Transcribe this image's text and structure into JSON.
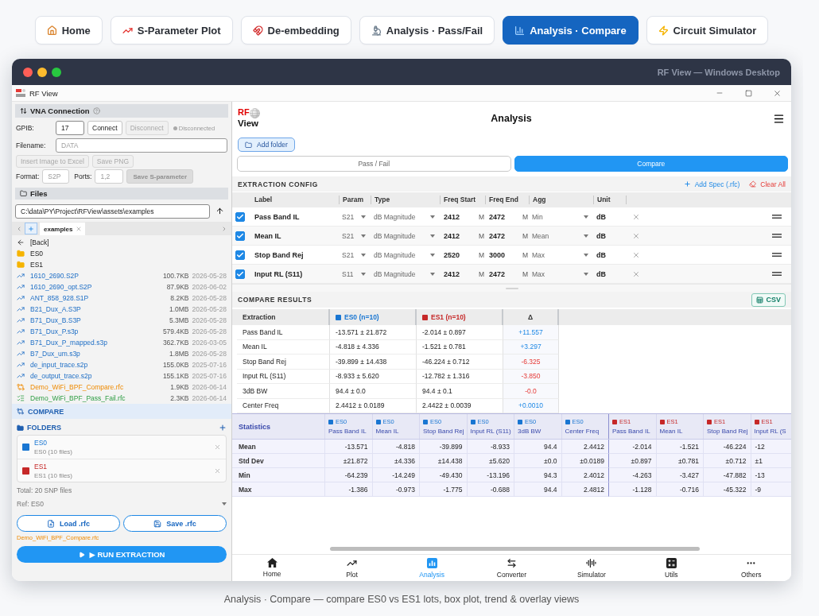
{
  "nav_tabs": [
    {
      "kind": "home",
      "label": "Home",
      "selected": false
    },
    {
      "kind": "plot",
      "label": "S-Parameter Plot",
      "selected": false
    },
    {
      "kind": "deembed",
      "label": "De-embedding",
      "selected": false
    },
    {
      "kind": "passfail",
      "label": "Analysis · Pass/Fail",
      "selected": false
    },
    {
      "kind": "compare",
      "label": "Analysis · Compare",
      "selected": true
    },
    {
      "kind": "simulator",
      "label": "Circuit Simulator",
      "selected": false
    }
  ],
  "window": {
    "title": "RF View — Windows Desktop",
    "app_title": "RF View"
  },
  "vna": {
    "title": "VNA Connection",
    "gpib_label": "GPIB:",
    "gpib": {
      "value": "17",
      "disabled": false
    },
    "connect": {
      "label": "Connect",
      "disabled": false
    },
    "disconnect": {
      "label": "Disconnect",
      "disabled": true
    },
    "connected": false,
    "status": "Disconnected",
    "filename_label": "Filename:",
    "filename": {
      "placeholder": "DATA"
    },
    "export_buttons": [
      {
        "label": "Insert Image to Excel",
        "disabled": true
      },
      {
        "label": "Save PNG",
        "disabled": true
      }
    ],
    "format_label": "Format:",
    "format": {
      "value": "S2P",
      "disabled": true
    },
    "ports_label": "Ports:",
    "ports": {
      "value": "1,2",
      "disabled": true
    },
    "save_button": {
      "label": "Save S-parameter",
      "disabled": true
    }
  },
  "files": {
    "title": "Files",
    "path": "C:\\data\\PY\\Project\\RFView\\assets\\examples",
    "tabs": [
      {
        "label": "examples",
        "selected": true
      }
    ],
    "items": [
      {
        "kind": "back",
        "name": "[Back]"
      },
      {
        "kind": "folder",
        "name": "ES0"
      },
      {
        "kind": "folder",
        "name": "ES1"
      },
      {
        "kind": "trace",
        "name": "1610_2690.S2P",
        "size": "100.7KB",
        "date": "2026-05-28"
      },
      {
        "kind": "trace",
        "name": "1610_2690_opt.S2P",
        "size": "87.9KB",
        "date": "2026-06-02"
      },
      {
        "kind": "trace",
        "name": "ANT_858_928.S1P",
        "size": "8.2KB",
        "date": "2026-05-28"
      },
      {
        "kind": "trace",
        "name": "B21_Dux_A.S3P",
        "size": "1.0MB",
        "date": "2026-05-28"
      },
      {
        "kind": "trace",
        "name": "B71_Dux_B.S3P",
        "size": "5.3MB",
        "date": "2026-05-28"
      },
      {
        "kind": "trace",
        "name": "B71_Dux_P.s3p",
        "size": "579.4KB",
        "date": "2026-05-28"
      },
      {
        "kind": "trace",
        "name": "B71_Dux_P_mapped.s3p",
        "size": "362.7KB",
        "date": "2026-03-05"
      },
      {
        "kind": "trace",
        "name": "B7_Dux_um.s3p",
        "size": "1.8MB",
        "date": "2026-05-28"
      },
      {
        "kind": "trace",
        "name": "de_input_trace.s2p",
        "size": "155.0KB",
        "date": "2025-07-16"
      },
      {
        "kind": "trace",
        "name": "de_output_trace.s2p",
        "size": "155.1KB",
        "date": "2025-07-16"
      },
      {
        "kind": "compare",
        "name": "Demo_WiFi_BPF_Compare.rfc",
        "size": "1.9KB",
        "date": "2026-06-14"
      },
      {
        "kind": "passfail",
        "name": "Demo_WiFi_BPF_Pass_Fail.rfc",
        "size": "2.3KB",
        "date": "2026-06-14"
      }
    ]
  },
  "compare": {
    "title": "COMPARE",
    "folders_title": "FOLDERS",
    "folders": [
      {
        "name": "ES0",
        "detail": "ES0 (10 files)",
        "color": "#1976d2"
      },
      {
        "name": "ES1",
        "detail": "ES1 (10 files)",
        "color": "#c62828"
      }
    ],
    "total": "Total: 20 SNP files",
    "ref": "Ref: ES0",
    "load_button": "Load .rfc",
    "save_button": "Save .rfc",
    "current_file": "Demo_WiFi_BPF_Compare.rfc",
    "run_button": "▶ RUN EXTRACTION"
  },
  "header": {
    "logo_top": "RF",
    "logo_bottom": "View",
    "title": "Analysis"
  },
  "add_folder": "Add folder",
  "mode_tabs": [
    {
      "label": "Pass / Fail",
      "selected": false
    },
    {
      "label": "Compare",
      "selected": true
    }
  ],
  "extraction_config": {
    "title": "EXTRACTION CONFIG",
    "add_spec": "Add Spec (.rfc)",
    "clear_all": "Clear All",
    "columns": [
      "Label",
      "Param",
      "Type",
      "Freq Start",
      "Freq End",
      "Agg",
      "Unit"
    ],
    "rows": [
      {
        "checked": true,
        "label": "Pass Band IL",
        "param": "S21",
        "type": "dB Magnitude",
        "freq_start": "2412",
        "freq_start_unit": "M",
        "freq_end": "2472",
        "freq_end_unit": "M",
        "agg": "Min",
        "unit": "dB"
      },
      {
        "checked": true,
        "label": "Mean IL",
        "param": "S21",
        "type": "dB Magnitude",
        "freq_start": "2412",
        "freq_start_unit": "M",
        "freq_end": "2472",
        "freq_end_unit": "M",
        "agg": "Mean",
        "unit": "dB"
      },
      {
        "checked": true,
        "label": "Stop Band Rej",
        "param": "S21",
        "type": "dB Magnitude",
        "freq_start": "2520",
        "freq_start_unit": "M",
        "freq_end": "3000",
        "freq_end_unit": "M",
        "agg": "Max",
        "unit": "dB"
      },
      {
        "checked": true,
        "label": "Input RL (S11)",
        "param": "S11",
        "type": "dB Magnitude",
        "freq_start": "2412",
        "freq_start_unit": "M",
        "freq_end": "2472",
        "freq_end_unit": "M",
        "agg": "Max",
        "unit": "dB"
      }
    ]
  },
  "compare_results": {
    "title": "COMPARE RESULTS",
    "csv_button": "CSV",
    "columns": [
      {
        "label": "Extraction"
      },
      {
        "label": "ES0 (n=10)",
        "color": "#1976d2"
      },
      {
        "label": "ES1 (n=10)",
        "color": "#c62828"
      },
      {
        "label": "Δ"
      }
    ],
    "rows": [
      {
        "label": "Pass Band IL",
        "es0": "-13.571 ± 21.872",
        "es1": "-2.014 ± 0.897",
        "delta": "+11.557",
        "kind": "gain"
      },
      {
        "label": "Mean IL",
        "es0": "-4.818 ± 4.336",
        "es1": "-1.521 ± 0.781",
        "delta": "+3.297",
        "kind": "gain"
      },
      {
        "label": "Stop Band Rej",
        "es0": "-39.899 ± 14.438",
        "es1": "-46.224 ± 0.712",
        "delta": "-6.325",
        "kind": "loss"
      },
      {
        "label": "Input RL (S11)",
        "es0": "-8.933 ± 5.620",
        "es1": "-12.782 ± 1.316",
        "delta": "-3.850",
        "kind": "loss"
      },
      {
        "label": "3dB BW",
        "es0": "94.4 ± 0.0",
        "es1": "94.4 ± 0.1",
        "delta": "-0.0",
        "kind": "loss"
      },
      {
        "label": "Center Freq",
        "es0": "2.4412 ± 0.0189",
        "es1": "2.4422 ± 0.0039",
        "delta": "+0.0010",
        "kind": "gain"
      }
    ]
  },
  "statistics": {
    "title": "Statistics",
    "columns": [
      {
        "group": "ES0",
        "label": "Pass Band IL",
        "color": "#1976d2"
      },
      {
        "group": "ES0",
        "label": "Mean IL",
        "color": "#1976d2"
      },
      {
        "group": "ES0",
        "label": "Stop Band Rej",
        "color": "#1976d2"
      },
      {
        "group": "ES0",
        "label": "Input RL (S11)",
        "color": "#1976d2"
      },
      {
        "group": "ES0",
        "label": "3dB BW",
        "color": "#1976d2"
      },
      {
        "group": "ES0",
        "label": "Center Freq",
        "color": "#1976d2"
      },
      {
        "group": "ES1",
        "label": "Pass Band IL",
        "color": "#c62828"
      },
      {
        "group": "ES1",
        "label": "Mean IL",
        "color": "#c62828"
      },
      {
        "group": "ES1",
        "label": "Stop Band Rej",
        "color": "#c62828"
      },
      {
        "group": "ES1",
        "label": "Input RL (S",
        "color": "#c62828"
      }
    ],
    "rows": [
      {
        "label": "Mean",
        "values": [
          "-13.571",
          "-4.818",
          "-39.899",
          "-8.933",
          "94.4",
          "2.4412",
          "-2.014",
          "-1.521",
          "-46.224",
          "-12"
        ]
      },
      {
        "label": "Std Dev",
        "values": [
          "±21.872",
          "±4.336",
          "±14.438",
          "±5.620",
          "±0.0",
          "±0.0189",
          "±0.897",
          "±0.781",
          "±0.712",
          "±1"
        ]
      },
      {
        "label": "Min",
        "values": [
          "-64.239",
          "-14.249",
          "-49.430",
          "-13.196",
          "94.3",
          "2.4012",
          "-4.263",
          "-3.427",
          "-47.882",
          "-13"
        ]
      },
      {
        "label": "Max",
        "values": [
          "-1.386",
          "-0.973",
          "-1.775",
          "-0.688",
          "94.4",
          "2.4812",
          "-1.128",
          "-0.716",
          "-45.322",
          "-9"
        ]
      }
    ]
  },
  "bottom_nav": [
    {
      "kind": "home",
      "label": "Home",
      "selected": false
    },
    {
      "kind": "plot",
      "label": "Plot",
      "selected": false
    },
    {
      "kind": "analysis",
      "label": "Analysis",
      "selected": true
    },
    {
      "kind": "converter",
      "label": "Converter",
      "selected": false
    },
    {
      "kind": "simulator",
      "label": "Simulator",
      "selected": false
    },
    {
      "kind": "utils",
      "label": "Utils",
      "selected": false
    },
    {
      "kind": "others",
      "label": "Others",
      "selected": false
    }
  ],
  "caption": "Analysis · Compare — compare ES0 vs ES1 lots, box plot, trend & overlay views"
}
